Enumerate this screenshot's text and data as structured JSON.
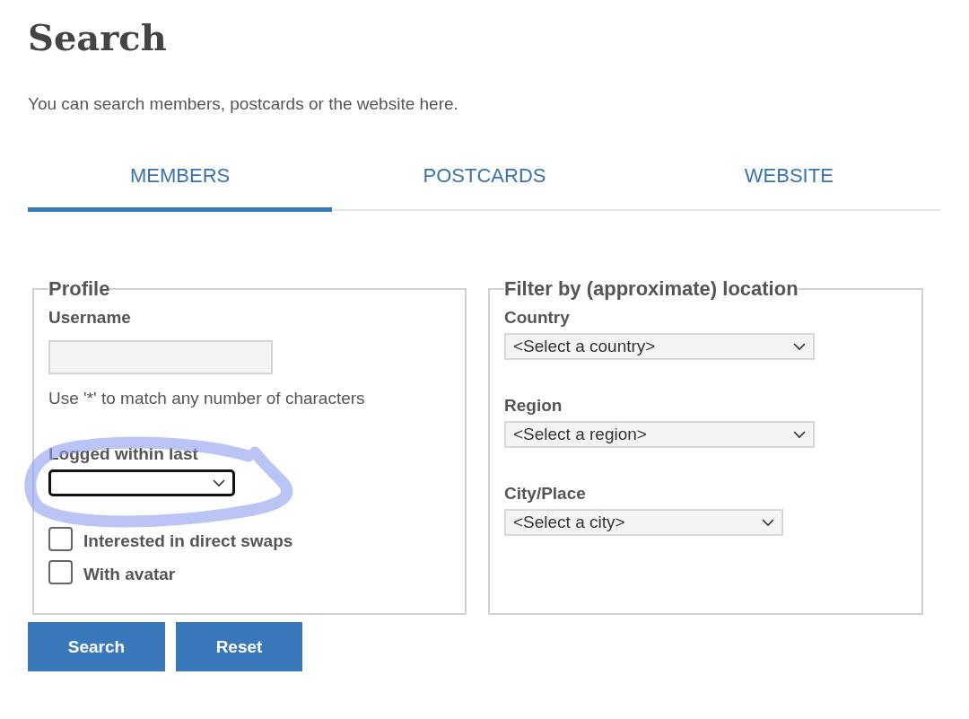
{
  "page": {
    "title": "Search",
    "intro": "You can search members, postcards or the website here."
  },
  "tabs": [
    {
      "label": "MEMBERS",
      "selected": true
    },
    {
      "label": "POSTCARDS",
      "selected": false
    },
    {
      "label": "WEBSITE",
      "selected": false
    }
  ],
  "fieldsets": [
    {
      "legend": "Profile",
      "fields": [
        {
          "kind": "text",
          "label": "Username"
        },
        {
          "kind": "hint",
          "text": "Use '*' to match any number of characters"
        },
        {
          "kind": "select",
          "label": "Logged within last",
          "focused": true
        },
        {
          "kind": "checkbox",
          "label": "Interested in direct swaps",
          "checked": false
        },
        {
          "kind": "checkbox",
          "label": "With avatar",
          "checked": false
        }
      ]
    },
    {
      "legend": "Filter by (approximate) location",
      "fields": [
        {
          "kind": "select",
          "label": "Country",
          "value": "<Select a country>",
          "focused": false
        },
        {
          "kind": "select",
          "label": "Region",
          "value": "<Select a region>",
          "focused": false
        },
        {
          "kind": "select",
          "label": "City/Place",
          "value": "<Select a city>",
          "focused": false
        }
      ]
    }
  ],
  "buttons": [
    "Search",
    "Reset"
  ]
}
